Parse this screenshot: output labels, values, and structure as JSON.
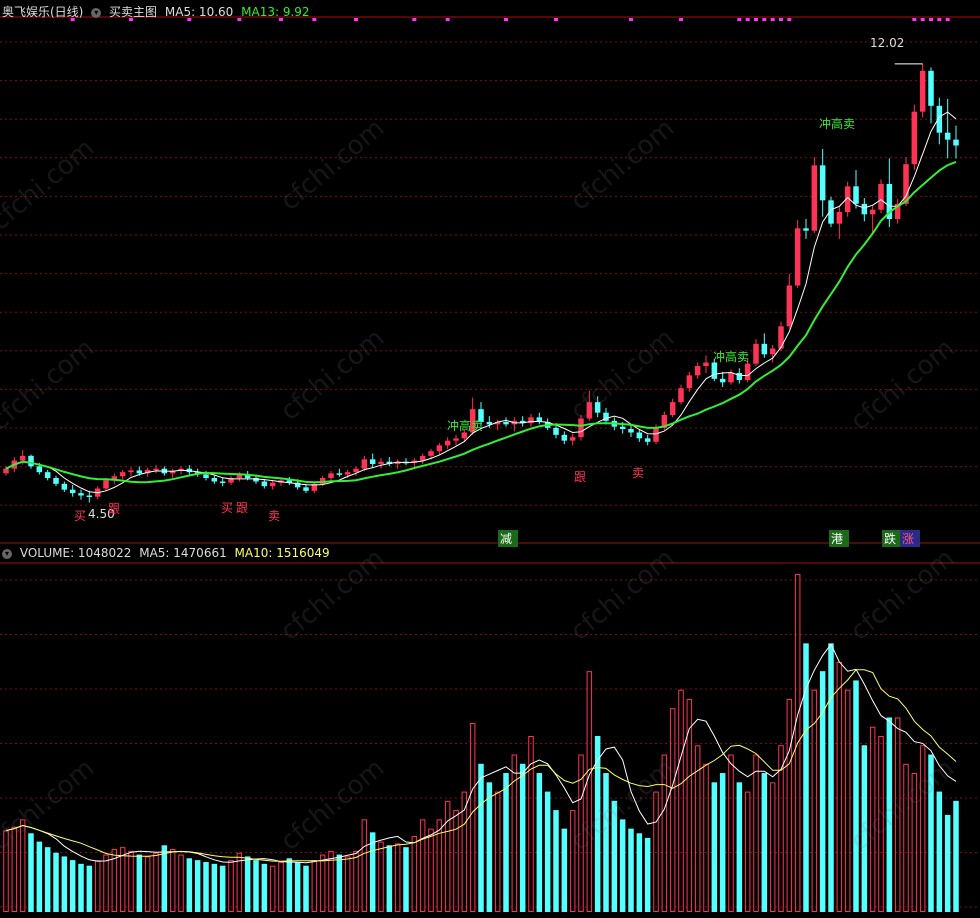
{
  "colors": {
    "bg": "#000000",
    "up": "#ff3355",
    "down": "#54ffff",
    "ma5": "#ffffff",
    "ma13": "#33ee33",
    "vol_ma10": "#ffff66",
    "grid": "#7a1010",
    "axis_border": "#a01010",
    "signal_dot": "#ff33ff",
    "header_text": "#dddddd",
    "header_ma13": "#33ee33",
    "header_vol_ma10": "#ffff66"
  },
  "price_panel": {
    "header": {
      "title": "奥飞娱乐(日线)",
      "indicator_name": "买卖主图",
      "ma5_label": "MA5: 10.60",
      "ma13_label": "MA13: 9.92"
    },
    "annotations": {
      "high": "12.02",
      "low": "4.50",
      "rush_high_sell": "冲高卖",
      "buy": "买",
      "follow": "跟",
      "sell": "卖",
      "reduce": "减",
      "port": "港",
      "fall": "跌",
      "rise": "涨"
    }
  },
  "volume_panel": {
    "header": {
      "volume_label": "VOLUME: 1048022",
      "ma5_label": "MA5: 1470661",
      "ma10_label": "MA10: 1516049"
    }
  },
  "watermark": "cfchi.com",
  "chart_data": [
    {
      "type": "candlestick",
      "title": "奥飞娱乐(日线)",
      "series_names": [
        "MA5",
        "MA13"
      ],
      "ylim": [
        4.2,
        12.6
      ],
      "ohlc": [
        [
          5.0,
          5.12,
          4.96,
          5.08
        ],
        [
          5.08,
          5.28,
          5.02,
          5.22
        ],
        [
          5.22,
          5.4,
          5.15,
          5.3
        ],
        [
          5.3,
          5.32,
          5.08,
          5.12
        ],
        [
          5.12,
          5.18,
          4.98,
          5.02
        ],
        [
          5.02,
          5.06,
          4.88,
          4.92
        ],
        [
          4.92,
          4.96,
          4.78,
          4.82
        ],
        [
          4.82,
          4.86,
          4.68,
          4.72
        ],
        [
          4.72,
          4.8,
          4.6,
          4.66
        ],
        [
          4.66,
          4.72,
          4.55,
          4.62
        ],
        [
          4.62,
          4.7,
          4.5,
          4.6
        ],
        [
          4.6,
          4.78,
          4.56,
          4.74
        ],
        [
          4.74,
          4.92,
          4.7,
          4.88
        ],
        [
          4.88,
          5.0,
          4.82,
          4.95
        ],
        [
          4.95,
          5.06,
          4.9,
          5.02
        ],
        [
          5.02,
          5.1,
          4.95,
          5.05
        ],
        [
          5.05,
          5.12,
          4.96,
          5.0
        ],
        [
          5.0,
          5.1,
          4.94,
          5.06
        ],
        [
          5.06,
          5.14,
          5.0,
          5.08
        ],
        [
          5.08,
          5.12,
          4.96,
          5.0
        ],
        [
          5.0,
          5.08,
          4.92,
          5.04
        ],
        [
          5.04,
          5.12,
          4.98,
          5.08
        ],
        [
          5.08,
          5.14,
          4.98,
          5.02
        ],
        [
          5.02,
          5.08,
          4.94,
          4.98
        ],
        [
          4.98,
          5.04,
          4.88,
          4.92
        ],
        [
          4.92,
          4.96,
          4.82,
          4.86
        ],
        [
          4.86,
          4.92,
          4.78,
          4.84
        ],
        [
          4.84,
          4.96,
          4.8,
          4.92
        ],
        [
          4.92,
          5.02,
          4.86,
          4.98
        ],
        [
          4.98,
          5.04,
          4.88,
          4.92
        ],
        [
          4.92,
          4.98,
          4.82,
          4.86
        ],
        [
          4.86,
          4.9,
          4.74,
          4.78
        ],
        [
          4.78,
          4.88,
          4.72,
          4.84
        ],
        [
          4.84,
          4.92,
          4.78,
          4.88
        ],
        [
          4.88,
          4.94,
          4.8,
          4.84
        ],
        [
          4.84,
          4.9,
          4.72,
          4.76
        ],
        [
          4.76,
          4.82,
          4.66,
          4.7
        ],
        [
          4.7,
          4.86,
          4.66,
          4.82
        ],
        [
          4.82,
          4.96,
          4.78,
          4.92
        ],
        [
          4.92,
          5.04,
          4.88,
          5.0
        ],
        [
          5.0,
          5.08,
          4.94,
          4.98
        ],
        [
          4.98,
          5.06,
          4.92,
          5.02
        ],
        [
          5.02,
          5.12,
          4.96,
          5.08
        ],
        [
          5.08,
          5.3,
          5.04,
          5.24
        ],
        [
          5.24,
          5.34,
          5.1,
          5.16
        ],
        [
          5.16,
          5.26,
          5.08,
          5.2
        ],
        [
          5.2,
          5.28,
          5.12,
          5.16
        ],
        [
          5.16,
          5.24,
          5.08,
          5.2
        ],
        [
          5.2,
          5.26,
          5.14,
          5.18
        ],
        [
          5.18,
          5.26,
          5.1,
          5.22
        ],
        [
          5.22,
          5.34,
          5.16,
          5.3
        ],
        [
          5.3,
          5.42,
          5.24,
          5.38
        ],
        [
          5.38,
          5.52,
          5.32,
          5.48
        ],
        [
          5.48,
          5.62,
          5.42,
          5.56
        ],
        [
          5.56,
          5.66,
          5.48,
          5.6
        ],
        [
          5.6,
          5.74,
          5.54,
          5.7
        ],
        [
          5.7,
          6.3,
          5.66,
          6.1
        ],
        [
          6.1,
          6.22,
          5.8,
          5.88
        ],
        [
          5.88,
          5.98,
          5.78,
          5.84
        ],
        [
          5.84,
          5.92,
          5.74,
          5.88
        ],
        [
          5.88,
          5.96,
          5.8,
          5.84
        ],
        [
          5.84,
          5.96,
          5.72,
          5.9
        ],
        [
          5.9,
          5.98,
          5.8,
          5.86
        ],
        [
          5.86,
          6.02,
          5.8,
          5.96
        ],
        [
          5.96,
          6.04,
          5.84,
          5.88
        ],
        [
          5.88,
          5.94,
          5.74,
          5.78
        ],
        [
          5.78,
          5.86,
          5.6,
          5.66
        ],
        [
          5.66,
          5.72,
          5.5,
          5.56
        ],
        [
          5.56,
          5.68,
          5.48,
          5.62
        ],
        [
          5.62,
          6.0,
          5.56,
          5.94
        ],
        [
          5.94,
          6.42,
          5.9,
          6.22
        ],
        [
          6.22,
          6.32,
          5.96,
          6.04
        ],
        [
          6.04,
          6.12,
          5.84,
          5.9
        ],
        [
          5.9,
          5.96,
          5.74,
          5.8
        ],
        [
          5.8,
          5.88,
          5.68,
          5.76
        ],
        [
          5.76,
          5.84,
          5.62,
          5.7
        ],
        [
          5.7,
          5.76,
          5.54,
          5.6
        ],
        [
          5.6,
          5.66,
          5.48,
          5.54
        ],
        [
          5.54,
          5.84,
          5.5,
          5.78
        ],
        [
          5.78,
          6.06,
          5.74,
          6.0
        ],
        [
          6.0,
          6.28,
          5.96,
          6.22
        ],
        [
          6.22,
          6.52,
          6.18,
          6.46
        ],
        [
          6.46,
          6.74,
          6.4,
          6.68
        ],
        [
          6.68,
          6.9,
          6.62,
          6.84
        ],
        [
          6.84,
          7.02,
          6.72,
          6.9
        ],
        [
          6.9,
          6.96,
          6.58,
          6.62
        ],
        [
          6.62,
          6.74,
          6.48,
          6.56
        ],
        [
          6.56,
          6.78,
          6.52,
          6.72
        ],
        [
          6.72,
          6.8,
          6.54,
          6.6
        ],
        [
          6.6,
          6.96,
          6.56,
          6.88
        ],
        [
          6.88,
          7.3,
          6.84,
          7.22
        ],
        [
          7.22,
          7.4,
          6.98,
          7.04
        ],
        [
          7.04,
          7.2,
          6.9,
          7.14
        ],
        [
          7.14,
          7.6,
          7.1,
          7.52
        ],
        [
          7.52,
          8.42,
          7.48,
          8.22
        ],
        [
          8.22,
          9.34,
          8.18,
          9.2
        ],
        [
          9.2,
          9.36,
          9.02,
          9.16
        ],
        [
          9.16,
          10.42,
          9.12,
          10.28
        ],
        [
          10.28,
          10.56,
          9.4,
          9.68
        ],
        [
          9.68,
          9.74,
          9.22,
          9.28
        ],
        [
          9.28,
          9.56,
          9.02,
          9.48
        ],
        [
          9.48,
          10.0,
          9.4,
          9.92
        ],
        [
          9.92,
          10.2,
          9.54,
          9.62
        ],
        [
          9.62,
          9.72,
          9.32,
          9.44
        ],
        [
          9.44,
          9.6,
          9.1,
          9.52
        ],
        [
          9.52,
          10.04,
          9.46,
          9.96
        ],
        [
          9.96,
          10.4,
          9.22,
          9.36
        ],
        [
          9.36,
          9.7,
          9.28,
          9.62
        ],
        [
          9.62,
          10.42,
          9.58,
          10.3
        ],
        [
          10.3,
          11.32,
          10.2,
          11.2
        ],
        [
          11.2,
          12.02,
          11.1,
          11.9
        ],
        [
          11.9,
          11.96,
          11.0,
          11.3
        ],
        [
          11.3,
          11.44,
          10.64,
          10.84
        ],
        [
          10.84,
          11.42,
          10.4,
          10.72
        ],
        [
          10.72,
          10.96,
          10.4,
          10.62
        ]
      ],
      "volume": [
        880000,
        920000,
        1000000,
        850000,
        760000,
        700000,
        640000,
        600000,
        560000,
        520000,
        500000,
        560000,
        620000,
        680000,
        700000,
        660000,
        620000,
        600000,
        640000,
        720000,
        680000,
        620000,
        580000,
        560000,
        540000,
        520000,
        500000,
        560000,
        640000,
        600000,
        560000,
        520000,
        500000,
        540000,
        580000,
        540000,
        500000,
        560000,
        620000,
        660000,
        620000,
        600000,
        660000,
        1000000,
        860000,
        760000,
        720000,
        740000,
        700000,
        820000,
        1000000,
        900000,
        1000000,
        1200000,
        1100000,
        1300000,
        2040000,
        1600000,
        1400000,
        1300000,
        1500000,
        1700000,
        1600000,
        1900000,
        1500000,
        1300000,
        1100000,
        900000,
        1100000,
        1700000,
        2600000,
        1900000,
        1500000,
        1200000,
        1000000,
        900000,
        850000,
        800000,
        1300000,
        1700000,
        2200000,
        2400000,
        2300000,
        1800000,
        1600000,
        1400000,
        1500000,
        1700000,
        1400000,
        1300000,
        1700000,
        1500000,
        1400000,
        1800000,
        2300000,
        3650000,
        2900000,
        2400000,
        2600000,
        2900000,
        2700000,
        2400000,
        2500000,
        1800000,
        2000000,
        1900000,
        2100000,
        2100000,
        1600000,
        1500000,
        1800000,
        1700000,
        1300000,
        1048022,
        1200000
      ],
      "signals_top": [
        8,
        15,
        22,
        28,
        33,
        37,
        42,
        49,
        53,
        60,
        66,
        75,
        81,
        88,
        89,
        90,
        91,
        92,
        93,
        94,
        109,
        110,
        111,
        112,
        113
      ]
    }
  ]
}
